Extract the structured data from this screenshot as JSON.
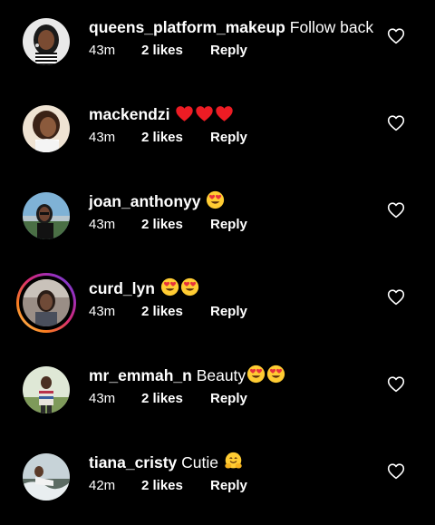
{
  "colors": {
    "background": "#000000",
    "text": "#ffffff",
    "heart_red": "#ed1c24",
    "emoji_yellow": "#ffcc33",
    "emoji_heart_eyes": "#e8323c"
  },
  "comments": [
    {
      "username": "queens_platform_makeup",
      "text": "Follow back",
      "emojis": [],
      "time": "43m",
      "likes": "2 likes",
      "reply": "Reply",
      "like_icon": "heart-outline-icon"
    },
    {
      "username": "mackendzi",
      "text": "",
      "emojis": [
        "red-heart-emoji",
        "red-heart-emoji",
        "red-heart-emoji"
      ],
      "time": "43m",
      "likes": "2 likes",
      "reply": "Reply",
      "like_icon": "heart-outline-icon"
    },
    {
      "username": "joan_anthonyy",
      "text": "",
      "emojis": [
        "heart-eyes-emoji"
      ],
      "time": "43m",
      "likes": "2 likes",
      "reply": "Reply",
      "like_icon": "heart-outline-icon"
    },
    {
      "username": "curd_lyn",
      "text": "",
      "emojis": [
        "heart-eyes-emoji",
        "heart-eyes-emoji"
      ],
      "time": "43m",
      "likes": "2 likes",
      "reply": "Reply",
      "like_icon": "heart-outline-icon",
      "has_story_ring": true
    },
    {
      "username": "mr_emmah_n",
      "text": "Beauty",
      "emojis": [
        "heart-eyes-emoji",
        "heart-eyes-emoji"
      ],
      "time": "43m",
      "likes": "2 likes",
      "reply": "Reply",
      "like_icon": "heart-outline-icon"
    },
    {
      "username": "tiana_cristy",
      "text": "Cutie",
      "emojis": [
        "hugging-face-emoji"
      ],
      "time": "42m",
      "likes": "2 likes",
      "reply": "Reply",
      "like_icon": "heart-outline-icon"
    }
  ]
}
